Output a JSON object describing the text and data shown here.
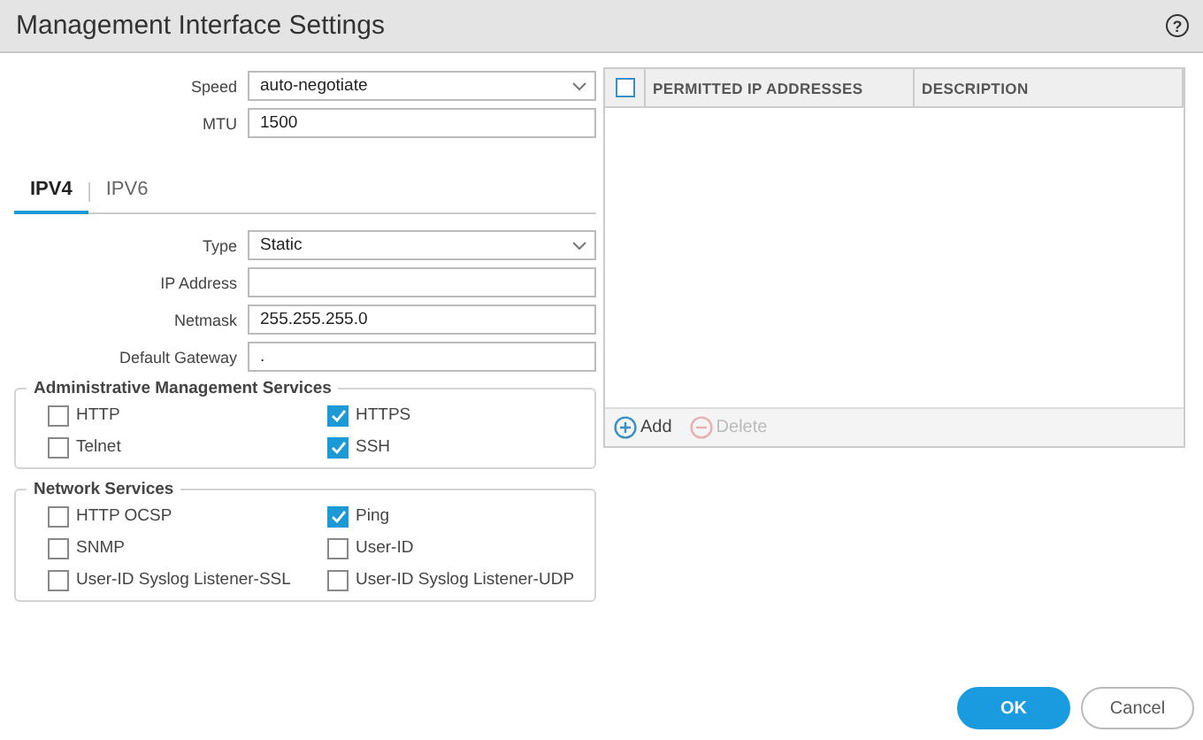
{
  "window": {
    "title": "Management Interface Settings",
    "help": "?"
  },
  "top_fields": [
    {
      "label": "Speed",
      "value": "auto-negotiate",
      "kind": "select"
    },
    {
      "label": "MTU",
      "value": "1500",
      "kind": "text"
    }
  ],
  "tabs": [
    {
      "label": "IPV4",
      "selected": true
    },
    {
      "label": "IPV6",
      "selected": false
    }
  ],
  "ip_fields": [
    {
      "label": "Type",
      "value": "Static",
      "kind": "select"
    },
    {
      "label": "IP Address",
      "kind": "text"
    },
    {
      "label": "Netmask",
      "value": "255.255.255.0",
      "kind": "text"
    },
    {
      "label": "Default Gateway",
      "value": ".",
      "kind": "text"
    }
  ],
  "groups": [
    {
      "title": "Administrative Management Services",
      "items": [
        {
          "label": "HTTP",
          "checked": false
        },
        {
          "label": "HTTPS",
          "checked": true
        },
        {
          "label": "Telnet",
          "checked": false
        },
        {
          "label": "SSH",
          "checked": true
        }
      ]
    },
    {
      "title": "Network Services",
      "items": [
        {
          "label": "HTTP OCSP",
          "checked": false
        },
        {
          "label": "Ping",
          "checked": true
        },
        {
          "label": "SNMP",
          "checked": false
        },
        {
          "label": "User-ID",
          "checked": false
        },
        {
          "label": "User-ID Syslog Listener-SSL",
          "checked": false
        },
        {
          "label": "User-ID Syslog Listener-UDP",
          "checked": false
        }
      ]
    }
  ],
  "table": {
    "select_all_checked": false,
    "columns": [
      "PERMITTED IP ADDRESSES",
      "DESCRIPTION"
    ],
    "actions": [
      {
        "label": "Add",
        "disabled": false,
        "kind": "add"
      },
      {
        "label": "Delete",
        "disabled": true,
        "kind": "delete"
      }
    ]
  },
  "buttons": [
    {
      "label": "OK",
      "kind": "primary"
    },
    {
      "label": "Cancel",
      "kind": "secondary"
    }
  ]
}
